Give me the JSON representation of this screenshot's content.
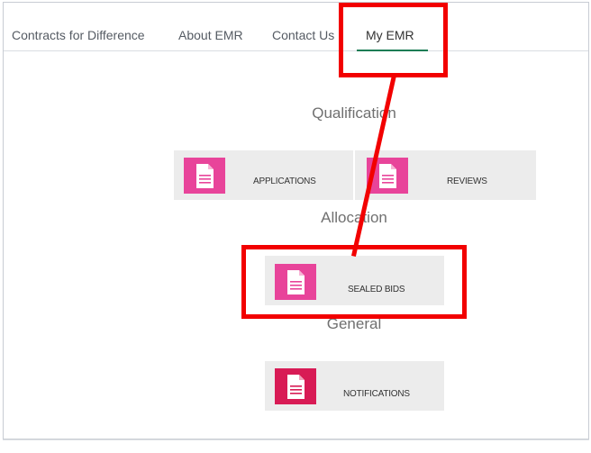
{
  "nav": {
    "items": [
      {
        "label": "Contracts for Difference"
      },
      {
        "label": "About EMR"
      },
      {
        "label": "Contact Us"
      },
      {
        "label": "My EMR"
      }
    ]
  },
  "sections": {
    "qualification": {
      "title": "Qualification",
      "tiles": [
        {
          "label": "APPLICATIONS",
          "icon": "document-icon"
        },
        {
          "label": "REVIEWS",
          "icon": "document-icon"
        }
      ]
    },
    "allocation": {
      "title": "Allocation",
      "tiles": [
        {
          "label": "SEALED BIDS",
          "icon": "document-icon"
        }
      ]
    },
    "general": {
      "title": "General",
      "tiles": [
        {
          "label": "NOTIFICATIONS",
          "icon": "document-icon"
        }
      ]
    }
  },
  "colors": {
    "tile_icon": "#e8449a",
    "notifications_icon": "#d81b55",
    "annotation": "#f20000",
    "nav_active_underline": "#1c7d55",
    "tile_background": "#ececec"
  }
}
